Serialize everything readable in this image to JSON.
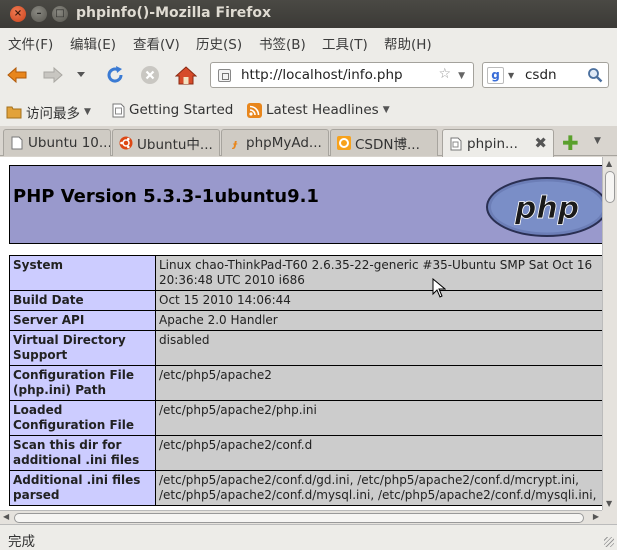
{
  "window": {
    "title": "phpinfo()-Mozilla Firefox",
    "close_glyph": "×",
    "min_glyph": "–",
    "max_glyph": "□"
  },
  "menu": [
    {
      "label": "文件(F)"
    },
    {
      "label": "编辑(E)"
    },
    {
      "label": "查看(V)"
    },
    {
      "label": "历史(S)"
    },
    {
      "label": "书签(B)"
    },
    {
      "label": "工具(T)"
    },
    {
      "label": "帮助(H)"
    }
  ],
  "nav": {
    "url": "http://localhost/info.php",
    "search_value": "csdn",
    "search_engine_icon": "google-icon"
  },
  "bookmarks": [
    {
      "label": "访问最多",
      "icon": "bookmark-folder-icon",
      "has_menu": true
    },
    {
      "label": "Getting Started",
      "icon": "page-icon",
      "has_menu": false
    },
    {
      "label": "Latest Headlines",
      "icon": "rss-icon",
      "has_menu": true
    }
  ],
  "tabs": [
    {
      "label": "Ubuntu 10...",
      "icon": "page-icon"
    },
    {
      "label": "Ubuntu中...",
      "icon": "ubuntu-icon"
    },
    {
      "label": "phpMyAd...",
      "icon": "phpmyadmin-icon"
    },
    {
      "label": "CSDN博...",
      "icon": "csdn-icon"
    },
    {
      "label": "phpin...",
      "icon": "page-icon",
      "active": true
    }
  ],
  "page": {
    "heading": "PHP Version 5.3.3-1ubuntu9.1",
    "logo_text": "php",
    "rows": [
      {
        "key": "System",
        "value": "Linux chao-ThinkPad-T60 2.6.35-22-generic #35-Ubuntu SMP Sat Oct 16 20:36:48 UTC 2010 i686"
      },
      {
        "key": "Build Date",
        "value": "Oct 15 2010 14:06:44"
      },
      {
        "key": "Server API",
        "value": "Apache 2.0 Handler"
      },
      {
        "key": "Virtual Directory Support",
        "value": "disabled"
      },
      {
        "key": "Configuration File (php.ini) Path",
        "value": "/etc/php5/apache2"
      },
      {
        "key": "Loaded Configuration File",
        "value": "/etc/php5/apache2/php.ini"
      },
      {
        "key": "Scan this dir for additional .ini files",
        "value": "/etc/php5/apache2/conf.d"
      },
      {
        "key": "Additional .ini files parsed",
        "value": "/etc/php5/apache2/conf.d/gd.ini, /etc/php5/apache2/conf.d/mcrypt.ini, /etc/php5/apache2/conf.d/mysql.ini, /etc/php5/apache2/conf.d/mysqli.ini,"
      }
    ]
  },
  "status": {
    "text": "完成"
  },
  "colors": {
    "php_header_bg": "#9999cc",
    "key_cell_bg": "#ccccff",
    "value_cell_bg": "#cccccc",
    "titlebar_bg": "#3f3e3a"
  }
}
